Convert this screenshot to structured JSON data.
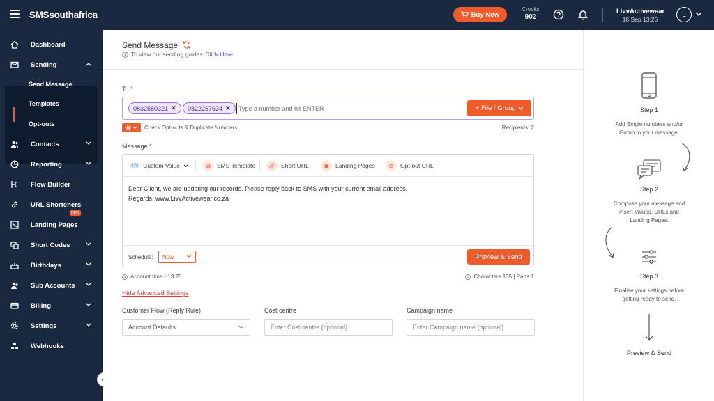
{
  "topbar": {
    "brand": "SMSsouthafrica",
    "buy_now": "Buy Now",
    "credits_label": "Credits",
    "credits_value": "902",
    "user_name": "LivvActivewear",
    "user_datetime": "18 Sep 13:25",
    "avatar_letter": "L"
  },
  "sidebar": {
    "items": [
      {
        "label": "Dashboard",
        "icon": "home-icon"
      },
      {
        "label": "Sending",
        "icon": "mail-icon"
      },
      {
        "label": "Contacts",
        "icon": "contacts-icon"
      },
      {
        "label": "Reporting",
        "icon": "report-icon"
      },
      {
        "label": "Flow Builder",
        "icon": "flow-icon",
        "badge": "NEW"
      },
      {
        "label": "URL Shorteners",
        "icon": "link-icon"
      },
      {
        "label": "Landing Pages",
        "icon": "landing-icon"
      },
      {
        "label": "Short Codes",
        "icon": "shortcode-icon"
      },
      {
        "label": "Birthdays",
        "icon": "cake-icon"
      },
      {
        "label": "Sub Accounts",
        "icon": "subaccounts-icon"
      },
      {
        "label": "Billing",
        "icon": "card-icon"
      },
      {
        "label": "Settings",
        "icon": "gear-icon"
      },
      {
        "label": "Webhooks",
        "icon": "webhook-icon"
      }
    ],
    "sending_sub": [
      "Send Message",
      "Templates",
      "Opt-outs"
    ]
  },
  "main": {
    "title": "Send Message",
    "guide_prefix": "To view our sending guides",
    "guide_link": "Click Here.",
    "to_label": "To",
    "to_req": "*",
    "recipients_chips": [
      "0832580321",
      "0822267634"
    ],
    "to_placeholder": "Type a number and hit ENTER",
    "file_group": "File / Group",
    "optout_check": "Check Opt-outs & Duplicate Numbers",
    "recipients_count": "Recipients: 2",
    "message_label": "Message",
    "message_req": "*",
    "toolbar": {
      "custom_value_badge": "123",
      "custom_value": "Custom Value",
      "sms_template": "SMS Template",
      "short_url": "Short URL",
      "landing_pages": "Landing Pages",
      "optout_url": "Opt-out URL"
    },
    "message_text": "Dear Client, we are updating our records. Please reply back to SMS with your current email address.\nRegards, www.LivvActivewear.co.za",
    "schedule_label": "Schedule:",
    "schedule_value": "Now",
    "preview_send": "Preview & Send",
    "account_time": "Account time - 13:25",
    "characters": "Characters 135 | Parts 1",
    "hide_advanced": "Hide Advanced Settings",
    "customer_flow_label": "Customer Flow (Reply Rule)",
    "customer_flow_value": "Account Defaults",
    "cost_centre_label": "Cost centre",
    "cost_centre_placeholder": "Enter Cost centre (optional)",
    "campaign_label": "Campaign name",
    "campaign_placeholder": "Enter Campaign name (optional)"
  },
  "steps": {
    "step1_title": "Step 1",
    "step1_desc": "Add Single numbers and/or\nGroup to your message.",
    "step2_title": "Step 2",
    "step2_desc": "Compose your message and\ninsert Values, URLs and\nLanding Pages.",
    "step3_title": "Step 3",
    "step3_desc": "Finalise your settings before\ngetting ready to send.",
    "final": "Preview & Send"
  },
  "colors": {
    "accent": "#f15a2b",
    "navy": "#1a2840",
    "chip": "#9b6fe0"
  }
}
